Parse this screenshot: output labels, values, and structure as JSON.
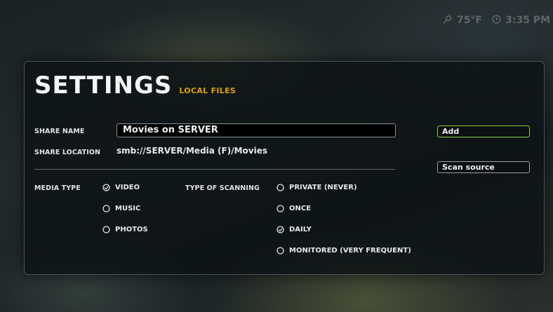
{
  "status": {
    "weather_icon": "weather-icon",
    "temperature": "75°F",
    "clock_icon": "clock-icon",
    "time": "3:35 PM"
  },
  "panel": {
    "title": "SETTINGS",
    "subtitle": "LOCAL FILES"
  },
  "form": {
    "share_name_label": "SHARE NAME",
    "share_name_value": "Movies on SERVER",
    "share_location_label": "SHARE LOCATION",
    "share_location_value": "smb://SERVER/Media (F)/Movies"
  },
  "buttons": {
    "add": "Add",
    "scan": "Scan source"
  },
  "media_type": {
    "label": "MEDIA TYPE",
    "options": [
      {
        "label": "VIDEO",
        "selected": true
      },
      {
        "label": "MUSIC",
        "selected": false
      },
      {
        "label": "PHOTOS",
        "selected": false
      }
    ]
  },
  "scanning": {
    "label": "TYPE OF SCANNING",
    "options": [
      {
        "label": "PRIVATE (NEVER)",
        "selected": false
      },
      {
        "label": "ONCE",
        "selected": false
      },
      {
        "label": "DAILY",
        "selected": true
      },
      {
        "label": "MONITORED (VERY FREQUENT)",
        "selected": false
      }
    ]
  },
  "colors": {
    "accent": "#e0a000",
    "focus": "#8bd13d",
    "panel_bg": "#0c1215"
  }
}
